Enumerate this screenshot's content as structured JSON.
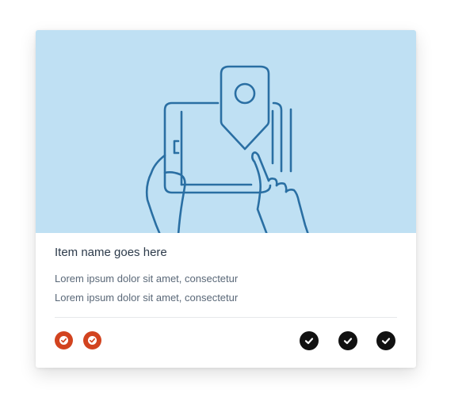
{
  "card": {
    "title": "Item name goes here",
    "description_lines": [
      "Lorem ipsum dolor sit amet, consectetur",
      "Lorem ipsum dolor sit amet, consectetur"
    ]
  },
  "icons": {
    "hero": "tablet-location-pin-illustration",
    "badges": [
      "check-badge-icon",
      "check-badge-icon"
    ],
    "actions": [
      "check-circle-icon",
      "check-circle-icon",
      "check-circle-icon"
    ]
  },
  "colors": {
    "hero_bg": "#bfe0f3",
    "illustration_stroke": "#2a6fa3",
    "badge": "#d2431f",
    "action": "#111111"
  }
}
